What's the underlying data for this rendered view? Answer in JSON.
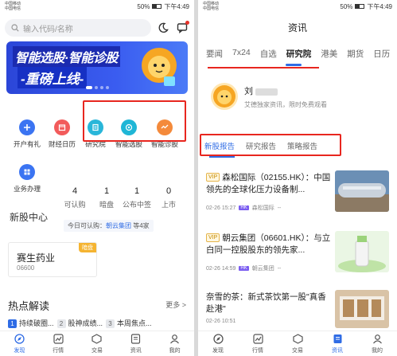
{
  "left": {
    "status": {
      "carrier1": "中国移动",
      "carrier2": "中国电信",
      "net": "46",
      "battery": "50%",
      "time": "下午4:49"
    },
    "search": {
      "placeholder": "输入代码/名称"
    },
    "banner": {
      "line1": "智能选股·智能诊股",
      "line2": "-重磅上线-"
    },
    "grid": [
      {
        "label": "开户有礼",
        "color": "#3b74f2",
        "icon": "plus-icon"
      },
      {
        "label": "财经日历",
        "color": "#f25b5b",
        "icon": "calendar-icon"
      },
      {
        "label": "研究院",
        "color": "#29b6d9",
        "icon": "document-icon"
      },
      {
        "label": "智能选股",
        "color": "#1fb6d6",
        "icon": "compass-icon"
      },
      {
        "label": "智能诊股",
        "color": "#f48a3b",
        "icon": "diagnose-icon"
      },
      {
        "label": "业务办理",
        "color": "#3b74f2",
        "icon": "apps-icon"
      }
    ],
    "ipo": {
      "title": "新股中心",
      "stats": [
        {
          "n": "4",
          "l": "可认购"
        },
        {
          "n": "1",
          "l": "暗盘"
        },
        {
          "n": "1",
          "l": "公布中签"
        },
        {
          "n": "0",
          "l": "上市"
        }
      ],
      "today_prefix": "今日可认购：",
      "today_link": "朝云集团",
      "today_suffix": " 等4家"
    },
    "stock": {
      "name": "赛生药业",
      "code": "06600",
      "tag": "暗盘"
    },
    "hot": {
      "title": "热点解读",
      "more": "更多 >",
      "items": [
        {
          "num": "1",
          "text": "持续破圈..."
        },
        {
          "num": "2",
          "text": "股神成绩..."
        },
        {
          "num": "3",
          "text": "本周焦点..."
        }
      ]
    },
    "tabs": [
      {
        "label": "发现",
        "icon": "discover-icon",
        "active": true
      },
      {
        "label": "行情",
        "icon": "quotes-icon",
        "active": false
      },
      {
        "label": "交易",
        "icon": "trade-icon",
        "active": false
      },
      {
        "label": "资讯",
        "icon": "news-icon",
        "active": false
      },
      {
        "label": "我的",
        "icon": "profile-icon",
        "active": false
      }
    ]
  },
  "right": {
    "status": {
      "carrier1": "中国移动",
      "carrier2": "中国电信",
      "net": "46",
      "battery": "50%",
      "time": "下午4:49"
    },
    "title": "资讯",
    "categories": [
      "要闻",
      "7x24",
      "自选",
      "研究院",
      "港美",
      "期货",
      "日历"
    ],
    "active_category": "研究院",
    "profile": {
      "name": "刘",
      "desc": "艾德独家资讯，限时免费观看"
    },
    "subtabs": [
      "新股报告",
      "研究报告",
      "策略报告"
    ],
    "news": [
      {
        "vip": "VIP",
        "headline": "森松国际（02155.HK）：中国领先的全球化压力设备制...",
        "date": "02-26 15:27",
        "market": "HK",
        "stock": "森松国际",
        "extra": "--"
      },
      {
        "vip": "VIP",
        "headline": "朝云集团（06601.HK）：与立白同一控股股东的领先家...",
        "date": "02-26 14:59",
        "market": "HK",
        "stock": "朝云集团",
        "extra": "--"
      },
      {
        "vip": "",
        "headline": "奈雪的茶：新式茶饮第一股\"真香赴港\"",
        "date": "02-26 10:51",
        "market": "",
        "stock": "",
        "extra": ""
      }
    ],
    "tabs": [
      {
        "label": "发现",
        "icon": "discover-icon",
        "active": false
      },
      {
        "label": "行情",
        "icon": "quotes-icon",
        "active": false
      },
      {
        "label": "交易",
        "icon": "trade-icon",
        "active": false
      },
      {
        "label": "资讯",
        "icon": "news-icon",
        "active": true
      },
      {
        "label": "我的",
        "icon": "profile-icon",
        "active": false
      }
    ]
  }
}
